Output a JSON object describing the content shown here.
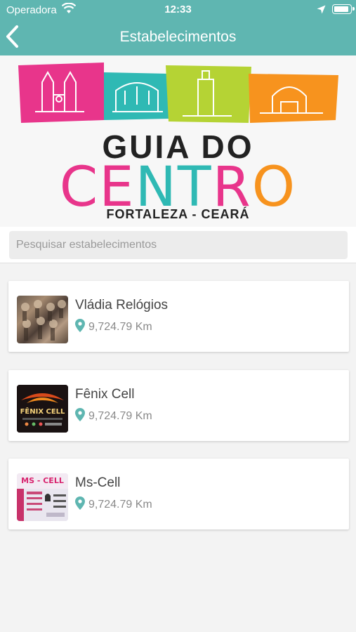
{
  "status_bar": {
    "carrier": "Operadora",
    "time": "12:33"
  },
  "header": {
    "title": "Estabelecimentos"
  },
  "banner": {
    "line1": "GUIA DO",
    "line2_letters": [
      {
        "char": "C",
        "color": "#e8358b"
      },
      {
        "char": "E",
        "color": "#e8358b"
      },
      {
        "char": "N",
        "color": "#2fb9b4"
      },
      {
        "char": "T",
        "color": "#2fb9b4"
      },
      {
        "char": "R",
        "color": "#e8358b"
      },
      {
        "char": "O",
        "color": "#f7931e"
      }
    ],
    "subtitle": "FORTALEZA - CEARÁ"
  },
  "search": {
    "placeholder": "Pesquisar estabelecimentos"
  },
  "establishments": [
    {
      "name": "Vládia Relógios",
      "distance": "9,724.79 Km"
    },
    {
      "name": "Fênix Cell",
      "distance": "9,724.79 Km",
      "thumb_text": "FÊNIX CELL"
    },
    {
      "name": "Ms-Cell",
      "distance": "9,724.79 Km",
      "thumb_text": "MS - CELL"
    }
  ],
  "colors": {
    "accent": "#5fb6b1",
    "pin": "#5fb6b1",
    "magenta": "#e8358b",
    "teal": "#2fb9b4",
    "lime": "#b5d334",
    "orange": "#f7931e"
  }
}
